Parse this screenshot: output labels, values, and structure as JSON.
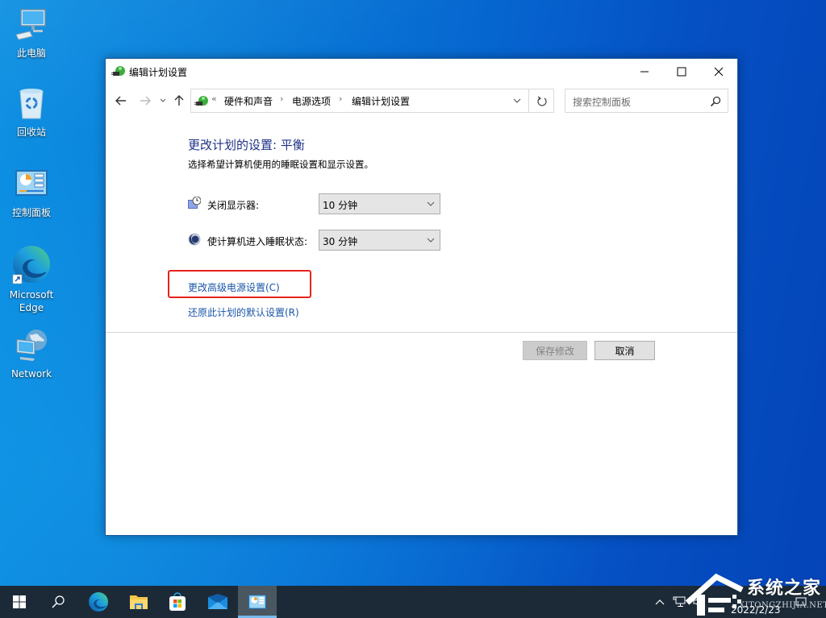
{
  "desktop": {
    "icons": [
      {
        "label": "此电脑",
        "icon": "computer-icon"
      },
      {
        "label": "回收站",
        "icon": "recycle-bin-icon"
      },
      {
        "label": "控制面板",
        "icon": "control-panel-icon"
      },
      {
        "label": "Microsoft Edge",
        "icon": "edge-icon"
      },
      {
        "label": "Network",
        "icon": "network-icon"
      }
    ]
  },
  "window": {
    "title": "编辑计划设置",
    "controls": {
      "minimize": "—",
      "maximize": "☐",
      "close": "✕"
    },
    "nav": {
      "back": "←",
      "forward": "→",
      "recent": "⌄",
      "up": "↑"
    },
    "address": {
      "overflow": "«",
      "crumbs": [
        "硬件和声音",
        "电源选项",
        "编辑计划设置"
      ],
      "separator": "›"
    },
    "search": {
      "placeholder": "搜索控制面板"
    },
    "content": {
      "title": "更改计划的设置: 平衡",
      "subtitle": "选择希望计算机使用的睡眠设置和显示设置。",
      "settings": [
        {
          "label": "关闭显示器:",
          "value": "10 分钟",
          "icon": "display-off-icon"
        },
        {
          "label": "使计算机进入睡眠状态:",
          "value": "30 分钟",
          "icon": "sleep-moon-icon"
        }
      ],
      "links": {
        "advanced": "更改高级电源设置(C)",
        "restore": "还原此计划的默认设置(R)"
      },
      "buttons": {
        "save": "保存修改",
        "cancel": "取消"
      }
    }
  },
  "taskbar": {
    "items": [
      "start",
      "search",
      "edge",
      "file-explorer",
      "store",
      "mail",
      "control-panel"
    ],
    "active": "control-panel",
    "clock_date": "2022/2/23"
  },
  "watermark": {
    "text": "系统之家",
    "url": "XITONGZHIJIA.NET"
  },
  "colors": {
    "link": "#1a55a8",
    "heading": "#1e3287",
    "highlight_box": "#e8231c",
    "taskbar": "#1c2a38"
  }
}
